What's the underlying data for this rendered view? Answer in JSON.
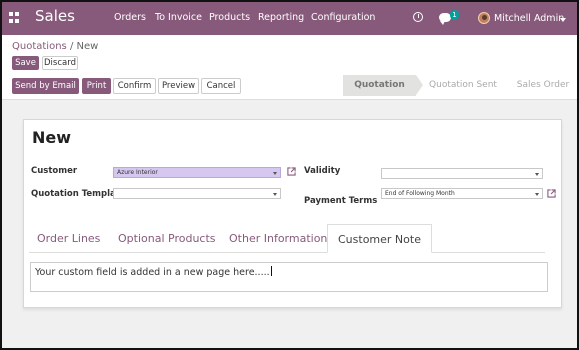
{
  "navbar": {
    "brand": "Sales",
    "menu": [
      "Orders",
      "To Invoice",
      "Products",
      "Reporting",
      "Configuration"
    ],
    "chat_badge": "1",
    "user_name": "Mitchell Admin",
    "color": "#875a7b"
  },
  "control_panel": {
    "breadcrumb_parent": "Quotations",
    "breadcrumb_separator": "/",
    "breadcrumb_current": "New",
    "save_label": "Save",
    "discard_label": "Discard",
    "send_email_label": "Send by Email",
    "print_label": "Print",
    "confirm_label": "Confirm",
    "preview_label": "Preview",
    "cancel_label": "Cancel",
    "status_steps": [
      "Quotation",
      "Quotation Sent",
      "Sales Order"
    ],
    "active_status": "Quotation"
  },
  "form": {
    "title": "New",
    "customer_label": "Customer",
    "customer_value": "Azure Interior",
    "template_label": "Quotation Template",
    "template_value": "",
    "validity_label": "Validity",
    "validity_value": "",
    "payment_terms_label": "Payment Terms",
    "payment_terms_value": "End of Following Month"
  },
  "tabs": {
    "items": [
      "Order Lines",
      "Optional Products",
      "Other Information",
      "Customer Note"
    ],
    "active": "Customer Note"
  },
  "note": {
    "text": "Your custom field is added in a new page here....."
  }
}
